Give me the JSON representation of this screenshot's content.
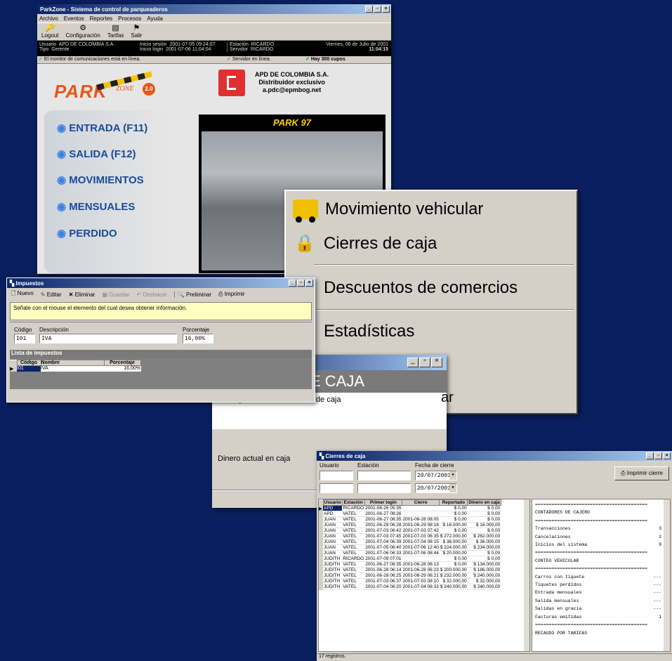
{
  "main": {
    "title": "ParkZone - Sistema de control de parqueaderos",
    "menu": [
      "Archivo",
      "Eventos",
      "Reportes",
      "Procesos",
      "Ayuda"
    ],
    "tools": [
      "Logout",
      "Configuración",
      "Tarifas",
      "Salir"
    ],
    "info": {
      "usuario_l": "Usuario",
      "usuario": "APD DE COLOMBIA S.A.",
      "tipo_l": "Tipo",
      "tipo": "Gerente",
      "ini_sesion_l": "Inicio sesión",
      "ini_sesion": "2001-07-05 09:24:07",
      "ini_login_l": "Inicio login",
      "ini_login": "2001-07-06 11:04:04",
      "estacion_l": "Estación",
      "estacion": "RICARDO",
      "servidor_l": "Servidor",
      "servidor": "RICARDO",
      "fecha": "Viernes, 06 de Julio de 2001",
      "hora": "11:04:15"
    },
    "status": [
      "El monitor de comunicaciones está en línea.",
      "Servidor en línea.",
      "Hay 300 cupos"
    ],
    "logo_park": "PARK",
    "logo_zone": "ZONE",
    "logo_ver": "2.0",
    "apd": [
      "APD DE COLOMBIA S.A.",
      "Distribuidor exclusivo",
      "a.pdc@epmbog.net"
    ],
    "park97": "PARK 97",
    "nav": [
      "ENTRADA (F11)",
      "SALIDA (F12)",
      "MOVIMIENTOS",
      "MENSUALES",
      "PERDIDO"
    ]
  },
  "menu_zoom": {
    "items": [
      "Movimiento vehicular",
      "Cierres de caja",
      "Descuentos de comercios",
      "Estadísticas"
    ]
  },
  "caja": {
    "banner": "E CAJA",
    "text": "Se dispone a hacer el cierre de caja",
    "dinero": "Dinero actual en caja",
    "cut": "ar"
  },
  "impuestos": {
    "title": "Impuestos",
    "tools": [
      "Nuevo",
      "Editar",
      "Eliminar",
      "Guardar",
      "Deshacer",
      "Preliminar",
      "Imprimir"
    ],
    "hint": "Señale con el mouse el elemento del cual desea obtener información.",
    "codigo_l": "Código",
    "codigo": "I01",
    "desc_l": "Descripción",
    "desc": "IVA",
    "pct_l": "Porcentaje",
    "pct": "16,00%",
    "lista": "Lista de impuestos",
    "cols": [
      "Código",
      "Nombre",
      "Porcentaje"
    ],
    "row": [
      "I01",
      "IVA",
      "16,00%"
    ]
  },
  "cierres": {
    "title": "Cierres de caja",
    "usuario_l": "Usuario",
    "estacion_l": "Estación",
    "fecha_l": "Fecha de cierre",
    "fecha1": "20/07/2001",
    "fecha2": "20/07/2001",
    "imprimir": "Imprimir cierre",
    "cols": [
      "Usuario",
      "Estación",
      "Primer login",
      "Cierre",
      "Reportado",
      "Dinero en caja"
    ],
    "rows": [
      [
        "APD",
        "RICARDO",
        "2001-06-26 05:35",
        "",
        "$ 0,00",
        "$ 0,00"
      ],
      [
        "APD",
        "VATEL",
        "2001-06-27 08:26",
        "",
        "$ 0,00",
        "$ 0,00"
      ],
      [
        "JUAN",
        "VATEL",
        "2001-06-27 08:35",
        "2001-06-28 08:05",
        "$ 0,00",
        "$ 0,00"
      ],
      [
        "JUAN",
        "VATEL",
        "2001-06-29 06:28",
        "2001-06-29 08:18",
        "$ 16.000,00",
        "$ 16.000,00"
      ],
      [
        "JUAN",
        "VATEL",
        "2001-07-03 06:42",
        "2001-07-03 07:42",
        "$ 0,00",
        "$ 0,00"
      ],
      [
        "JUAN",
        "VATEL",
        "2001-07-03 07:45",
        "2001-07-03 06:35",
        "$ 272.000,00",
        "$ 262.000,00"
      ],
      [
        "JUAN",
        "VATEL",
        "2001-07-04 06:39",
        "2001-07-04 08:15",
        "$ 36.000,00",
        "$ 36.000,00"
      ],
      [
        "JUAN",
        "VATEL",
        "2001-07-05 06:40",
        "2001-07-06 12:40",
        "$ 224.000,00",
        "$ 234.000,00"
      ],
      [
        "JUAN",
        "VATEL",
        "2001-07-06 06:33",
        "2001-07-06 08:44",
        "$ 20.000,00",
        "$ 0,00"
      ],
      [
        "JUDITH",
        "RICARDO",
        "2001-07-09 07:01",
        "",
        "$ 0,00",
        "$ 0,00"
      ],
      [
        "JUDITH",
        "VATEL",
        "2001-06-27 08:35",
        "2001-06-28 06:13",
        "$ 0,00",
        "$ 134.000,00"
      ],
      [
        "JUDITH",
        "VATEL",
        "2001-06-28 06:14",
        "2001-06-28 06:23",
        "$ 200.000,00",
        "$ 186.000,00"
      ],
      [
        "JUDITH",
        "VATEL",
        "2001-06-28 06:25",
        "2001-06-29 06:21",
        "$ 232.000,00",
        "$ 240.000,00"
      ],
      [
        "JUDITH",
        "VATEL",
        "2001-07-03 06:37",
        "2001-07-03 08:10",
        "$ 32.000,00",
        "$ 32.000,00"
      ],
      [
        "JUDITH",
        "VATEL",
        "2001-07-04 06:20",
        "2001-07-04 06:32",
        "$ 240.000,00",
        "$ 240.000,00"
      ]
    ],
    "report": [
      [
        "=========================================",
        ""
      ],
      [
        "CONTADORES DE CAJERO",
        ""
      ],
      [
        "=========================================",
        ""
      ],
      [
        "Transacciones",
        "3"
      ],
      [
        "Cancelaciones",
        "2"
      ],
      [
        "Inicios del sistema",
        "9"
      ],
      [
        "=========================================",
        ""
      ],
      [
        "CONTEO VEHICULAR",
        ""
      ],
      [
        "=========================================",
        ""
      ],
      [
        "Carros con tiquete",
        "---"
      ],
      [
        "Tiquetes perdidos",
        "---"
      ],
      [
        "Entrada mensuales",
        "---"
      ],
      [
        "Salida mensuales",
        "---"
      ],
      [
        "Salidas en gracia",
        "---"
      ],
      [
        "Facturas emitidas",
        "1"
      ],
      [
        "=========================================",
        ""
      ],
      [
        "RECAUDO POR TARIFAS",
        ""
      ]
    ],
    "registros": "17 registros."
  }
}
